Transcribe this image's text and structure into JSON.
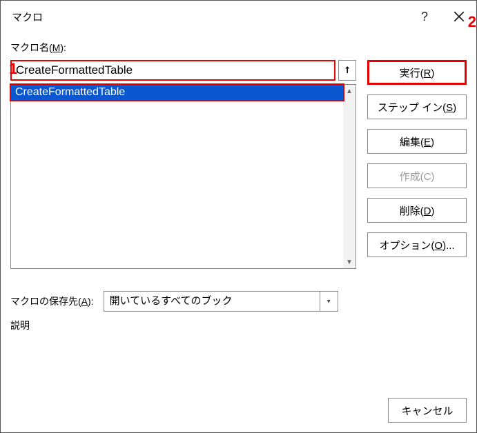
{
  "titlebar": {
    "title": "マクロ",
    "help": "?",
    "close": "✕"
  },
  "labels": {
    "macro_name_prefix": "マクロ名(",
    "macro_name_key": "M",
    "macro_name_suffix": "):",
    "storage_prefix": "マクロの保存先(",
    "storage_key": "A",
    "storage_suffix": "):",
    "description": "説明"
  },
  "macro_name_value": "CreateFormattedTable",
  "list": {
    "items": [
      "CreateFormattedTable"
    ]
  },
  "buttons": {
    "run_prefix": "実行(",
    "run_key": "R",
    "run_suffix": ")",
    "stepin_prefix": "ステップ イン(",
    "stepin_key": "S",
    "stepin_suffix": ")",
    "edit_prefix": "編集(",
    "edit_key": "E",
    "edit_suffix": ")",
    "create_prefix": "作成(",
    "create_key": "C",
    "create_suffix": ")",
    "delete_prefix": "削除(",
    "delete_key": "D",
    "delete_suffix": ")",
    "options_prefix": "オプション(",
    "options_key": "O",
    "options_suffix": ")...",
    "cancel": "キャンセル"
  },
  "storage_value": "開いているすべてのブック",
  "annotations": {
    "n1": "1",
    "n2": "2"
  }
}
